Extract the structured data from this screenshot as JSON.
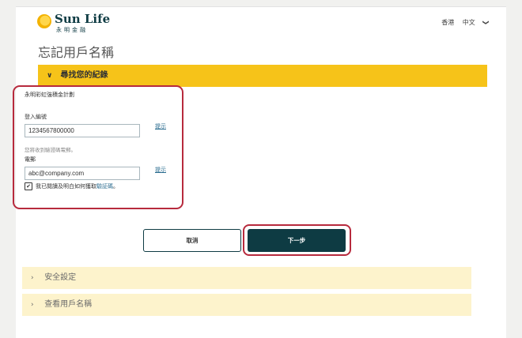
{
  "header": {
    "brand_name": "Sun Life",
    "brand_name_zh": "永明金融",
    "region": "香港",
    "language": "中文",
    "language_chevron": "❯"
  },
  "page_title": "忘記用戶名稱",
  "sections": {
    "find_record": {
      "title": "尋找您的紀錄",
      "icon": "chevron-down-icon"
    },
    "security_settings": {
      "title": "安全設定",
      "icon": "chevron-right-icon"
    },
    "view_username": {
      "title": "查看用戶名稱",
      "icon": "chevron-right-icon"
    }
  },
  "form": {
    "plan_name": "永明彩虹強積金計劃",
    "login_label": "登入編號",
    "login_value": "1234567800000",
    "login_hint": "提示",
    "verification_note": "您將收到驗證碼電郵。",
    "email_label": "電郵",
    "email_value": "abc@company.com",
    "email_hint": "提示",
    "consent_checked": true,
    "consent_text": "我已閱讀及明白如何獲取",
    "consent_link": "驗証碼",
    "consent_end": "。"
  },
  "buttons": {
    "cancel": "取消",
    "next": "下一步"
  },
  "colors": {
    "accent_yellow": "#f6c319",
    "pale_yellow": "#fdf3cc",
    "brand_teal": "#0e3b43",
    "highlight_red": "#b72a3d",
    "link_blue": "#2a6c8f"
  }
}
